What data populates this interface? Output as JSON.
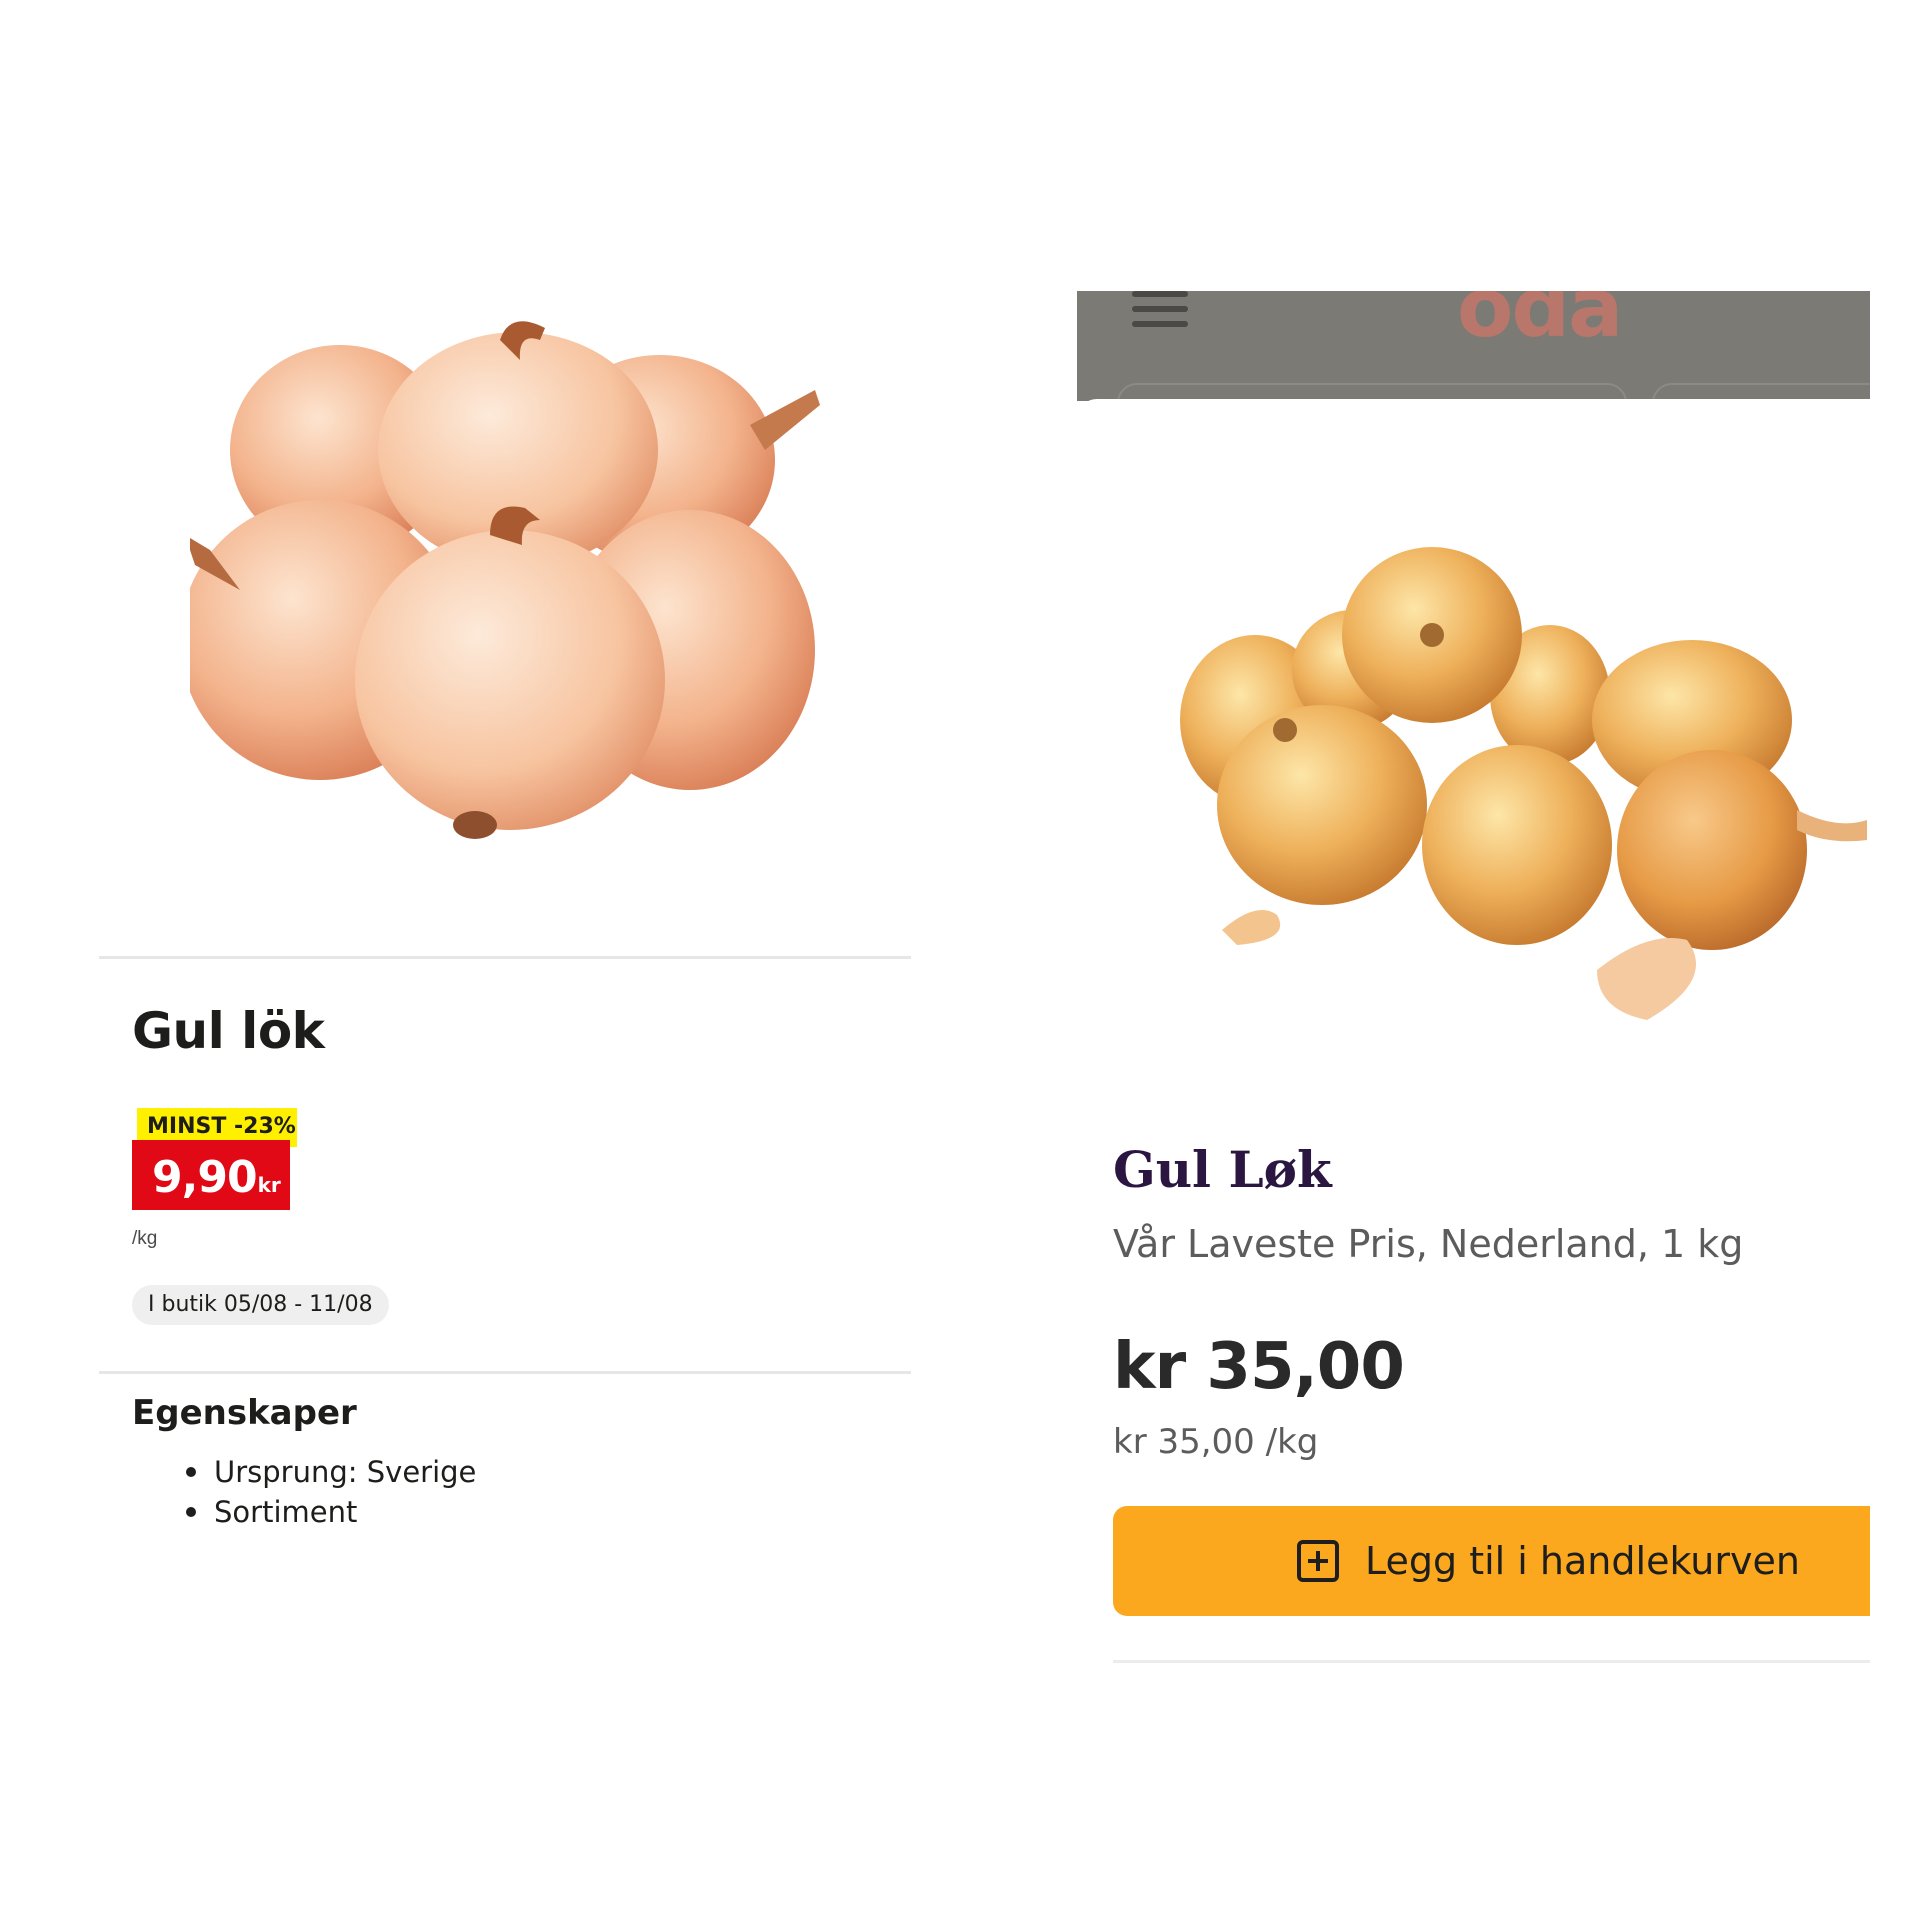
{
  "lidl": {
    "product_title": "Gul lök",
    "badge": "MINST -23%",
    "price": "9,90",
    "price_currency": "kr",
    "per_unit": "/kg",
    "availability": "I butik 05/08 - 11/08",
    "properties_title": "Egenskaper",
    "properties": [
      "Ursprung: Sverige",
      "Sortiment"
    ],
    "colors": {
      "badge_yellow": "#fff000",
      "price_red": "#e10915"
    }
  },
  "oda": {
    "logo": "oda",
    "product_title": "Gul Løk",
    "subtitle": "Vår Laveste Pris, Nederland, 1 kg",
    "price": "kr 35,00",
    "unit_price": "kr 35,00 /kg",
    "cart_button": "Legg til i handlekurven",
    "colors": {
      "cart_button": "#fba81f",
      "title": "#2a1640",
      "topbar_overlay": "#7c7a75"
    }
  }
}
